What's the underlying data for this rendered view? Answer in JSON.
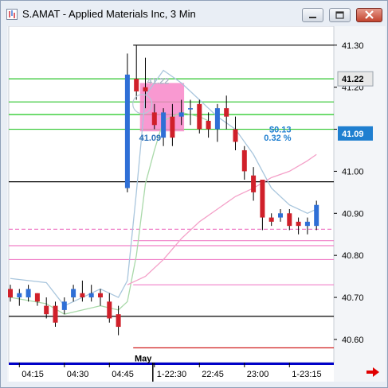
{
  "window": {
    "title": "S.AMAT - Applied Materials Inc, 3 Min",
    "min_icon": "minimize-icon",
    "max_icon": "maximize-icon",
    "close_icon": "close-icon",
    "scroll_icon": "scroll-right-arrow-icon"
  },
  "colors": {
    "up": "#2f6fd6",
    "down": "#d0202a",
    "label_bg": "#1f7fd0",
    "highlight_bg": "#e8e8e8",
    "zone": "#f77fc6",
    "accent": "#d60000"
  },
  "chart_data": {
    "type": "candlestick",
    "y_axis": {
      "ylim": [
        40.545,
        41.345
      ],
      "ticks": [
        "41.30",
        "41.20",
        "41.10",
        "41.00",
        "40.90",
        "40.80",
        "40.70",
        "40.60"
      ],
      "price_labels": [
        {
          "text": "41.22",
          "value": 41.22,
          "style": "highlight"
        },
        {
          "text": "41.09",
          "value": 41.09,
          "style": "current"
        }
      ]
    },
    "x_axis": {
      "ticks": [
        {
          "label": "04:15",
          "i": 1
        },
        {
          "label": "04:30",
          "i": 6
        },
        {
          "label": "04:45",
          "i": 11
        },
        {
          "label": "1-22:30",
          "i": 16
        },
        {
          "label": "22:45",
          "i": 21
        },
        {
          "label": "23:00",
          "i": 26
        },
        {
          "label": "1-23:15",
          "i": 31
        }
      ],
      "session_markers": [
        16
      ]
    },
    "candles": [
      {
        "o": 40.72,
        "h": 40.73,
        "l": 40.69,
        "c": 40.7
      },
      {
        "o": 40.7,
        "h": 40.72,
        "l": 40.68,
        "c": 40.71
      },
      {
        "o": 40.7,
        "h": 40.73,
        "l": 40.69,
        "c": 40.72
      },
      {
        "o": 40.71,
        "h": 40.71,
        "l": 40.68,
        "c": 40.69
      },
      {
        "o": 40.68,
        "h": 40.7,
        "l": 40.65,
        "c": 40.66
      },
      {
        "o": 40.68,
        "h": 40.69,
        "l": 40.63,
        "c": 40.64
      },
      {
        "o": 40.67,
        "h": 40.7,
        "l": 40.66,
        "c": 40.69
      },
      {
        "o": 40.7,
        "h": 40.73,
        "l": 40.69,
        "c": 40.72
      },
      {
        "o": 40.71,
        "h": 40.74,
        "l": 40.69,
        "c": 40.7
      },
      {
        "o": 40.7,
        "h": 40.73,
        "l": 40.69,
        "c": 40.71
      },
      {
        "o": 40.71,
        "h": 40.72,
        "l": 40.68,
        "c": 40.7
      },
      {
        "o": 40.69,
        "h": 40.71,
        "l": 40.64,
        "c": 40.65
      },
      {
        "o": 40.66,
        "h": 40.68,
        "l": 40.61,
        "c": 40.63
      },
      {
        "o": 40.96,
        "h": 41.28,
        "l": 40.95,
        "c": 41.23
      },
      {
        "o": 41.22,
        "h": 41.3,
        "l": 41.17,
        "c": 41.19
      },
      {
        "o": 41.2,
        "h": 41.27,
        "l": 41.15,
        "c": 41.19
      },
      {
        "o": 41.14,
        "h": 41.16,
        "l": 41.1,
        "c": 41.11
      },
      {
        "o": 41.08,
        "h": 41.15,
        "l": 41.06,
        "c": 41.14
      },
      {
        "o": 41.13,
        "h": 41.16,
        "l": 41.06,
        "c": 41.08
      },
      {
        "o": 41.13,
        "h": 41.17,
        "l": 41.11,
        "c": 41.14
      },
      {
        "o": 41.15,
        "h": 41.17,
        "l": 41.11,
        "c": 41.15
      },
      {
        "o": 41.16,
        "h": 41.17,
        "l": 41.09,
        "c": 41.1
      },
      {
        "o": 41.12,
        "h": 41.14,
        "l": 41.08,
        "c": 41.1
      },
      {
        "o": 41.1,
        "h": 41.16,
        "l": 41.07,
        "c": 41.15
      },
      {
        "o": 41.15,
        "h": 41.18,
        "l": 41.1,
        "c": 41.13
      },
      {
        "o": 41.1,
        "h": 41.13,
        "l": 41.05,
        "c": 41.07
      },
      {
        "o": 41.05,
        "h": 41.06,
        "l": 40.98,
        "c": 41.0
      },
      {
        "o": 40.99,
        "h": 41.01,
        "l": 40.93,
        "c": 40.95
      },
      {
        "o": 40.98,
        "h": 40.98,
        "l": 40.86,
        "c": 40.89
      },
      {
        "o": 40.89,
        "h": 40.9,
        "l": 40.87,
        "c": 40.88
      },
      {
        "o": 40.89,
        "h": 40.91,
        "l": 40.88,
        "c": 40.9
      },
      {
        "o": 40.9,
        "h": 40.91,
        "l": 40.86,
        "c": 40.87
      },
      {
        "o": 40.88,
        "h": 40.89,
        "l": 40.85,
        "c": 40.87
      },
      {
        "o": 40.87,
        "h": 40.89,
        "l": 40.85,
        "c": 40.88
      },
      {
        "o": 40.87,
        "h": 40.93,
        "l": 40.86,
        "c": 40.92
      }
    ],
    "levels": [
      {
        "y": 41.3,
        "color": "#000000",
        "from": 14
      },
      {
        "y": 41.22,
        "color": "#2fc62f",
        "from": 0
      },
      {
        "y": 41.165,
        "color": "#2fc62f",
        "from": 0
      },
      {
        "y": 41.135,
        "color": "#00c000",
        "from": 0
      },
      {
        "y": 41.1,
        "color": "#2fc62f",
        "from": 0
      },
      {
        "y": 40.975,
        "color": "#000000",
        "from": 0
      },
      {
        "y": 40.862,
        "color": "#f080c8",
        "from": 0,
        "dash": true
      },
      {
        "y": 40.835,
        "color": "#f080c8",
        "from": 14
      },
      {
        "y": 40.823,
        "color": "#f080c8",
        "from": 0
      },
      {
        "y": 40.79,
        "color": "#f080c8",
        "from": 0
      },
      {
        "y": 40.73,
        "color": "#f080c8",
        "from": 14
      },
      {
        "y": 40.655,
        "color": "#000000",
        "from": 0
      },
      {
        "y": 40.58,
        "color": "#d02020",
        "from": 14
      }
    ],
    "zone": {
      "from": 14.4,
      "to": 19.3,
      "y_top": 41.21,
      "y_bottom": 41.095
    },
    "overlays": [
      {
        "text": "41.22",
        "x": 15.2,
        "y": 41.215,
        "color": "#a9b6c6"
      },
      {
        "text": "41.09",
        "x": 14.3,
        "y": 41.08,
        "color": "#2a6eb8"
      },
      {
        "text": "$0.13",
        "x": 31.2,
        "y": 41.1,
        "color": "#1f7fd0",
        "anchor": "end"
      },
      {
        "text": "0.32 %",
        "x": 31.2,
        "y": 41.08,
        "color": "#1f7fd0",
        "anchor": "end"
      },
      {
        "text": "May",
        "x": 13.8,
        "y": 40.555,
        "color": "#000000"
      }
    ],
    "bands": [
      {
        "name": "",
        "color": "#a9c6dd",
        "points": [
          [
            0,
            40.745
          ],
          [
            4,
            40.735
          ],
          [
            6,
            40.68
          ],
          [
            8,
            40.7
          ],
          [
            10,
            40.72
          ],
          [
            12,
            40.7
          ],
          [
            13,
            40.74
          ],
          [
            14,
            40.95
          ],
          [
            15,
            41.18
          ],
          [
            17,
            41.24
          ],
          [
            19,
            41.21
          ],
          [
            21,
            41.17
          ],
          [
            23,
            41.13
          ],
          [
            25,
            41.1
          ],
          [
            27,
            41.04
          ],
          [
            29,
            40.96
          ],
          [
            31,
            40.92
          ],
          [
            33,
            40.9
          ],
          [
            34,
            40.91
          ]
        ]
      },
      {
        "name": "",
        "color": "#a9d9a9",
        "points": [
          [
            0,
            40.7
          ],
          [
            4,
            40.685
          ],
          [
            6,
            40.66
          ],
          [
            8,
            40.67
          ],
          [
            10,
            40.68
          ],
          [
            12,
            40.67
          ],
          [
            13,
            40.69
          ],
          [
            14,
            40.8
          ],
          [
            15,
            40.97
          ],
          [
            16,
            41.05
          ],
          [
            17,
            41.12
          ],
          [
            19,
            41.14
          ],
          [
            21,
            41.13
          ],
          [
            22,
            41.12
          ]
        ]
      },
      {
        "name": "",
        "color": "#f4a0c8",
        "points": [
          [
            13,
            40.73
          ],
          [
            15,
            40.75
          ],
          [
            17,
            40.79
          ],
          [
            19,
            40.84
          ],
          [
            21,
            40.88
          ],
          [
            23,
            40.91
          ],
          [
            25,
            40.94
          ],
          [
            27,
            40.96
          ],
          [
            29,
            40.985
          ],
          [
            31,
            41.0
          ],
          [
            33,
            41.025
          ],
          [
            34,
            41.04
          ]
        ]
      }
    ]
  }
}
